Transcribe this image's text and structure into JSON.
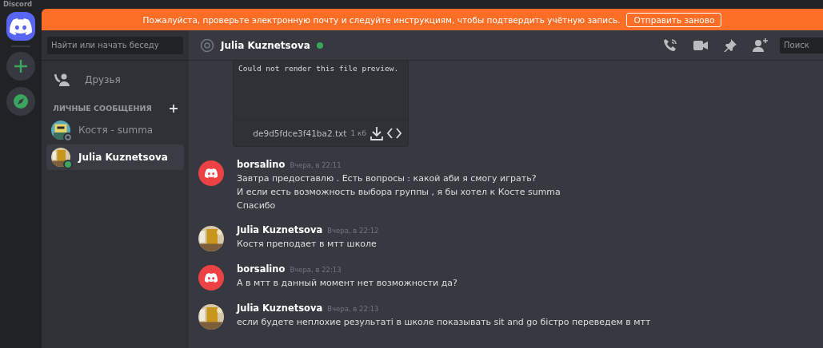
{
  "app_title": "Discord",
  "servers": [
    {
      "kind": "home",
      "selected": true
    },
    {
      "kind": "add"
    },
    {
      "kind": "explore"
    }
  ],
  "banner": {
    "text": "Пожалуйста, проверьте электронную почту и следуйте инструкциям, чтобы подтвердить учётную запись.",
    "button": "Отправить заново"
  },
  "sidebar": {
    "search": {
      "placeholder": "Найти или начать беседу"
    },
    "friends": "Друзья",
    "dm_heading": "ЛИЧНЫЕ СООБЩЕНИЯ",
    "dms": [
      {
        "name": "Костя - summa",
        "online": false,
        "selected": false
      },
      {
        "name": "Julia Kuznetsova",
        "online": true,
        "selected": true
      }
    ]
  },
  "header": {
    "name": "Julia Kuznetsova",
    "online": true,
    "search": {
      "placeholder": "Поиск"
    }
  },
  "attachment": {
    "preview": "Could not render this file preview.",
    "filename": "de9d5fdce3f41ba2.txt",
    "size": "1 кб"
  },
  "messages": [
    {
      "author": "borsalino",
      "kind": "discord",
      "time": "Вчера, в 22:11",
      "lines": [
        "Завтра предоставлю . Есть вопросы : какой аби я смогу играть?",
        "И если есть возможность выбора группы , я бы хотел к Косте summa",
        "Спасибо"
      ]
    },
    {
      "author": "Julia Kuznetsova",
      "time": "Вчера, в 22:12",
      "lines": [
        "Костя преподает в мтт школе"
      ]
    },
    {
      "author": "borsalino",
      "kind": "discord",
      "time": "Вчера, в 22:13",
      "lines": [
        "А в мтт в данный момент нет возможности да?"
      ]
    },
    {
      "author": "Julia Kuznetsova",
      "time": "Вчера, в 22:13",
      "lines": [
        "если будете неплохие результаті в школе показывать sit and go бістро переведем в мтт"
      ]
    }
  ]
}
